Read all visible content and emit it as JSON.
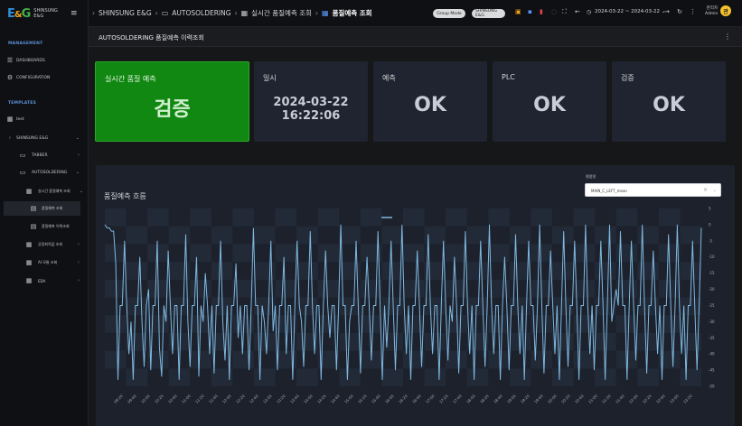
{
  "sidebar": {
    "logo_text": "SHINSUNG\nE&G",
    "sections": [
      {
        "title": "MANAGEMENT"
      },
      {
        "title": "TEMPLATES"
      }
    ],
    "management_items": [
      {
        "label": "DASHBOARDS",
        "icon": "sliders-icon"
      },
      {
        "label": "CONFIGURATION",
        "icon": "gear-icon"
      }
    ],
    "template_items": [
      {
        "label": "test",
        "icon": "grid-icon"
      },
      {
        "label": "SHINSUNG E&G"
      },
      {
        "label": "TABBER"
      },
      {
        "label": "AUTOSOLDERING"
      },
      {
        "label": "실시간 품질예측 조회"
      },
      {
        "label": "품질예측 조회"
      },
      {
        "label": "품질예측 이력조회"
      },
      {
        "label": "공정최적값 조회"
      },
      {
        "label": "AI 모듈 조회"
      },
      {
        "label": "EDA"
      }
    ]
  },
  "topbar": {
    "crumbs": [
      "SHINSUNG E&G",
      "AUTOSOLDERING",
      "실시간 품질예측 조회",
      "품질예측 조회"
    ],
    "pill_group": "Group Mode",
    "pill_company": "SHINSUNG E&G",
    "date_range": "2024-03-22 ~ 2024-03-22",
    "user_name": "관리자",
    "user_role": "Admin",
    "avatar_letter": "관"
  },
  "page": {
    "title": "AUTOSOLDERING 품질예측 이력조회"
  },
  "cards": [
    {
      "label": "실시간 품질 예측",
      "value": "검증",
      "color": "#118811"
    },
    {
      "label": "일시",
      "value_line1": "2024-03-22",
      "value_line2": "16:22:06"
    },
    {
      "label": "예측",
      "value": "OK"
    },
    {
      "label": "PLC",
      "value": "OK"
    },
    {
      "label": "검증",
      "value": "OK"
    }
  ],
  "panel": {
    "title": "품질예측 흐름",
    "select_label": "컬럼명",
    "select_value": "MAIN_C_LEFT_mean"
  },
  "chart_data": {
    "type": "line",
    "legend_placement": "top-center",
    "grid": true,
    "ylim": [
      -50,
      5
    ],
    "y_ticks": [
      5,
      0,
      -5,
      -10,
      -15,
      -20,
      -25,
      -30,
      -35,
      -40,
      -45,
      -50
    ],
    "x_ticks": [
      "09:20",
      "09:40",
      "10:00",
      "10:20",
      "10:40",
      "11:00",
      "11:20",
      "11:40",
      "12:00",
      "12:20",
      "12:40",
      "13:00",
      "13:20",
      "13:40",
      "14:00",
      "14:20",
      "14:40",
      "15:00",
      "15:20",
      "15:40",
      "16:00",
      "16:20",
      "16:40",
      "17:00",
      "17:20",
      "17:40",
      "18:00",
      "18:20",
      "18:40",
      "19:00",
      "19:20",
      "19:40",
      "20:00",
      "20:20",
      "20:40",
      "21:00",
      "21:20",
      "21:40",
      "22:00",
      "22:20",
      "22:40",
      "23:00",
      "23:20"
    ],
    "series": [
      {
        "color": "#7eb8e0",
        "values": [
          0,
          -1,
          -1,
          -2,
          -2,
          -12,
          -48,
          -25,
          -25,
          -5,
          -25,
          -40,
          -30,
          -48,
          -25,
          -25,
          -10,
          -30,
          -44,
          -25,
          -20,
          -45,
          -25,
          -25,
          -5,
          -38,
          -47,
          -25,
          -30,
          -8,
          -25,
          -40,
          -25,
          -25,
          -48,
          -25,
          -25,
          -3,
          -30,
          -44,
          -25,
          -25,
          -10,
          -47,
          -25,
          -30,
          -15,
          -25,
          -40,
          -25,
          -46,
          -25,
          -25,
          -5,
          -30,
          -42,
          -25,
          -48,
          -25,
          -25,
          -12,
          -35,
          -25,
          -40,
          -25,
          -25,
          -45,
          -25,
          -1,
          -25,
          -25,
          -48,
          -25,
          -30,
          -40,
          -25,
          -5,
          -33,
          -25,
          -45,
          -25,
          -25,
          -10,
          -40,
          -25,
          -25,
          -48,
          -25,
          -5,
          -25,
          -30,
          -44,
          -25,
          -25,
          -2,
          -25,
          -40,
          -25,
          -25,
          -48,
          -25,
          -8,
          -25,
          -35,
          -25,
          -25,
          -45,
          -25,
          0,
          -25,
          -25,
          -48,
          -30,
          -25,
          -25,
          -5,
          -25,
          -46,
          -25,
          -25,
          -10,
          -25,
          -42,
          -25,
          -25,
          -2,
          -25,
          -48,
          -25,
          -38,
          -25,
          -5,
          -25,
          -45,
          -25,
          -25,
          0,
          -25,
          -40,
          -25,
          -48,
          -25,
          -25,
          -8,
          -25,
          -44,
          -25,
          -25,
          -3,
          -25,
          -40,
          -25,
          -25,
          -48,
          -25,
          -5,
          -25,
          -42,
          -25,
          -30,
          -10,
          -25,
          -46,
          -25,
          -25,
          -2,
          -25,
          -40,
          -25,
          -48,
          -25,
          -25,
          -5,
          -25,
          -44,
          -25,
          0,
          -25,
          -40,
          -25,
          -25,
          -48,
          -25,
          -10,
          -25,
          -45,
          -25,
          -25,
          -3,
          -25,
          -40,
          -25,
          -48,
          -25,
          -5,
          -25,
          -25,
          -42,
          -25,
          0,
          -25,
          -46,
          -25,
          -25,
          -8,
          -25,
          -40,
          -25,
          -48,
          -25,
          -2,
          -25,
          -44,
          -25,
          -25,
          -5,
          -25,
          -48,
          -25,
          -25,
          0,
          -25,
          -40,
          -25,
          -45,
          -25,
          -25,
          -5,
          -25,
          -48,
          -25,
          0,
          -30,
          -25,
          -20,
          -25,
          -2,
          -25,
          -25,
          -48,
          -25,
          -5,
          -25,
          -42,
          -25,
          -25,
          0,
          -25,
          -46,
          -25,
          -25,
          -8,
          -25,
          -40,
          -25,
          -48,
          -25,
          -25,
          -3,
          -25,
          -44,
          -25,
          0,
          -25,
          -40,
          -25,
          -48,
          -25,
          -25,
          -5,
          -25,
          -45,
          -25,
          -1
        ]
      }
    ]
  }
}
